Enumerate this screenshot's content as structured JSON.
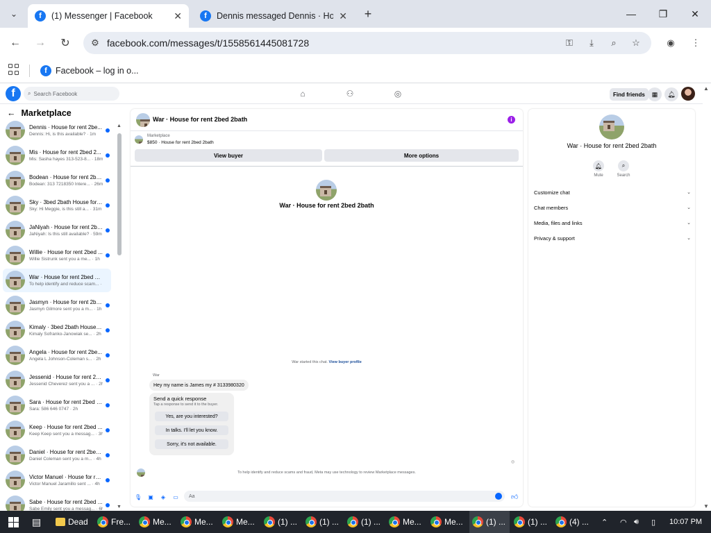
{
  "browser": {
    "tabs": [
      {
        "title": "(1) Messenger | Facebook",
        "active": true
      },
      {
        "title": "Dennis messaged Dennis · Hou",
        "active": false
      }
    ],
    "url": "facebook.com/messages/t/1558561445081728",
    "bookmark": "Facebook – log in o..."
  },
  "fbnav": {
    "search_placeholder": "Search Facebook",
    "find_friends": "Find friends"
  },
  "sidebar": {
    "heading": "Marketplace",
    "conversations": [
      {
        "name": "Dennis · House for rent 2be...",
        "preview": "Dennis: Hi, is this available? · 1m",
        "unread": true
      },
      {
        "name": "Mis · House for rent 2bed 2...",
        "preview": "Mis: Sasha hayes 313-523-8... · 18m",
        "unread": true
      },
      {
        "name": "Bodean · House for rent 2be...",
        "preview": "Bodean: 313 7218350 Intere... · 26m",
        "unread": true
      },
      {
        "name": "Sky · 3bed 2bath House for ...",
        "preview": "Sky: Hi Meggie, is this still a... · 31m",
        "unread": true
      },
      {
        "name": "JaNiyah · House for rent 2be...",
        "preview": "JaNiyah: Is this still available? · 59m",
        "unread": true
      },
      {
        "name": "Willie · House for rent 2bed ...",
        "preview": "Willie Sistrunk sent you a me... · 1h",
        "unread": true
      },
      {
        "name": "War · House for rent 2bed 2ba...",
        "preview": "To help identify and reduce scam... · 1h",
        "unread": false,
        "selected": true
      },
      {
        "name": "Jasmyn · House for rent 2be...",
        "preview": "Jasmyn Gilmore sent you a m... · 1h",
        "unread": true
      },
      {
        "name": "Kimaly · 3bed 2bath House f...",
        "preview": "Kimaly Sofranko-Janowiak se... · 2h",
        "unread": true
      },
      {
        "name": "Angela · House for rent 2be...",
        "preview": "Angela L Johnson-Coleman s... · 2h",
        "unread": true
      },
      {
        "name": "Jessenid · House for rent 2be...",
        "preview": "Jessenid Cheverez sent you a ... · 2h",
        "unread": true
      },
      {
        "name": "Sara · House for rent 2bed 2b...",
        "preview": "Sara: 586 646 0747 · 2h",
        "unread": true
      },
      {
        "name": "Keep · House for rent 2bed ...",
        "preview": "Keep Keep sent you a messag... · 3h",
        "unread": true
      },
      {
        "name": "Daniel · House for rent 2bed...",
        "preview": "Daniel Coleman sent you a m... · 4h",
        "unread": true
      },
      {
        "name": "Victor Manuel · House for re...",
        "preview": "Victor Manuel Jaramillo sent ... · 4h",
        "unread": true
      },
      {
        "name": "Sabe · House for rent 2bed ...",
        "preview": "Sabe Emily sent you a messag... · 6h",
        "unread": true
      }
    ]
  },
  "chat": {
    "title": "War · House for rent 2bed 2bath",
    "marketplace_label": "Marketplace",
    "listing": "$850 · House for rent 2bed 2bath",
    "view_buyer": "View buyer",
    "more_options": "More options",
    "center_title": "War · House for rent 2bed 2bath",
    "started_text": "War started this chat.",
    "view_buyer_profile": "View buyer profile",
    "sender": "War",
    "message": "Hey my name is James my # 3133980320",
    "quick_reply": {
      "heading": "Send a quick response",
      "subheading": "Tap a response to send it to the buyer.",
      "options": [
        "Yes, are you interested?",
        "In talks. I'll let you know.",
        "Sorry, it's not available."
      ]
    },
    "notice": "To help identify and reduce scams and fraud, Meta may use technology to review Marketplace messages.",
    "composer_placeholder": "Aa"
  },
  "info_panel": {
    "title": "War · House for rent 2bed 2bath",
    "actions": [
      {
        "label": "Mute"
      },
      {
        "label": "Search"
      }
    ],
    "sections": [
      "Customize chat",
      "Chat members",
      "Media, files and links",
      "Privacy & support"
    ]
  },
  "taskbar": {
    "items": [
      "Dead",
      "Fre...",
      "Me...",
      "Me...",
      "Me...",
      "(1) ...",
      "(1) ...",
      "(1) ...",
      "Me...",
      "Me...",
      "(1) ...",
      "(1) ...",
      "(4) ..."
    ],
    "time": "10:07 PM"
  },
  "colors": {
    "facebook_blue": "#1877f2",
    "unread_dot": "#0866ff",
    "selected_bg": "#ebf5ff",
    "info_purple": "#9b1fe8"
  }
}
